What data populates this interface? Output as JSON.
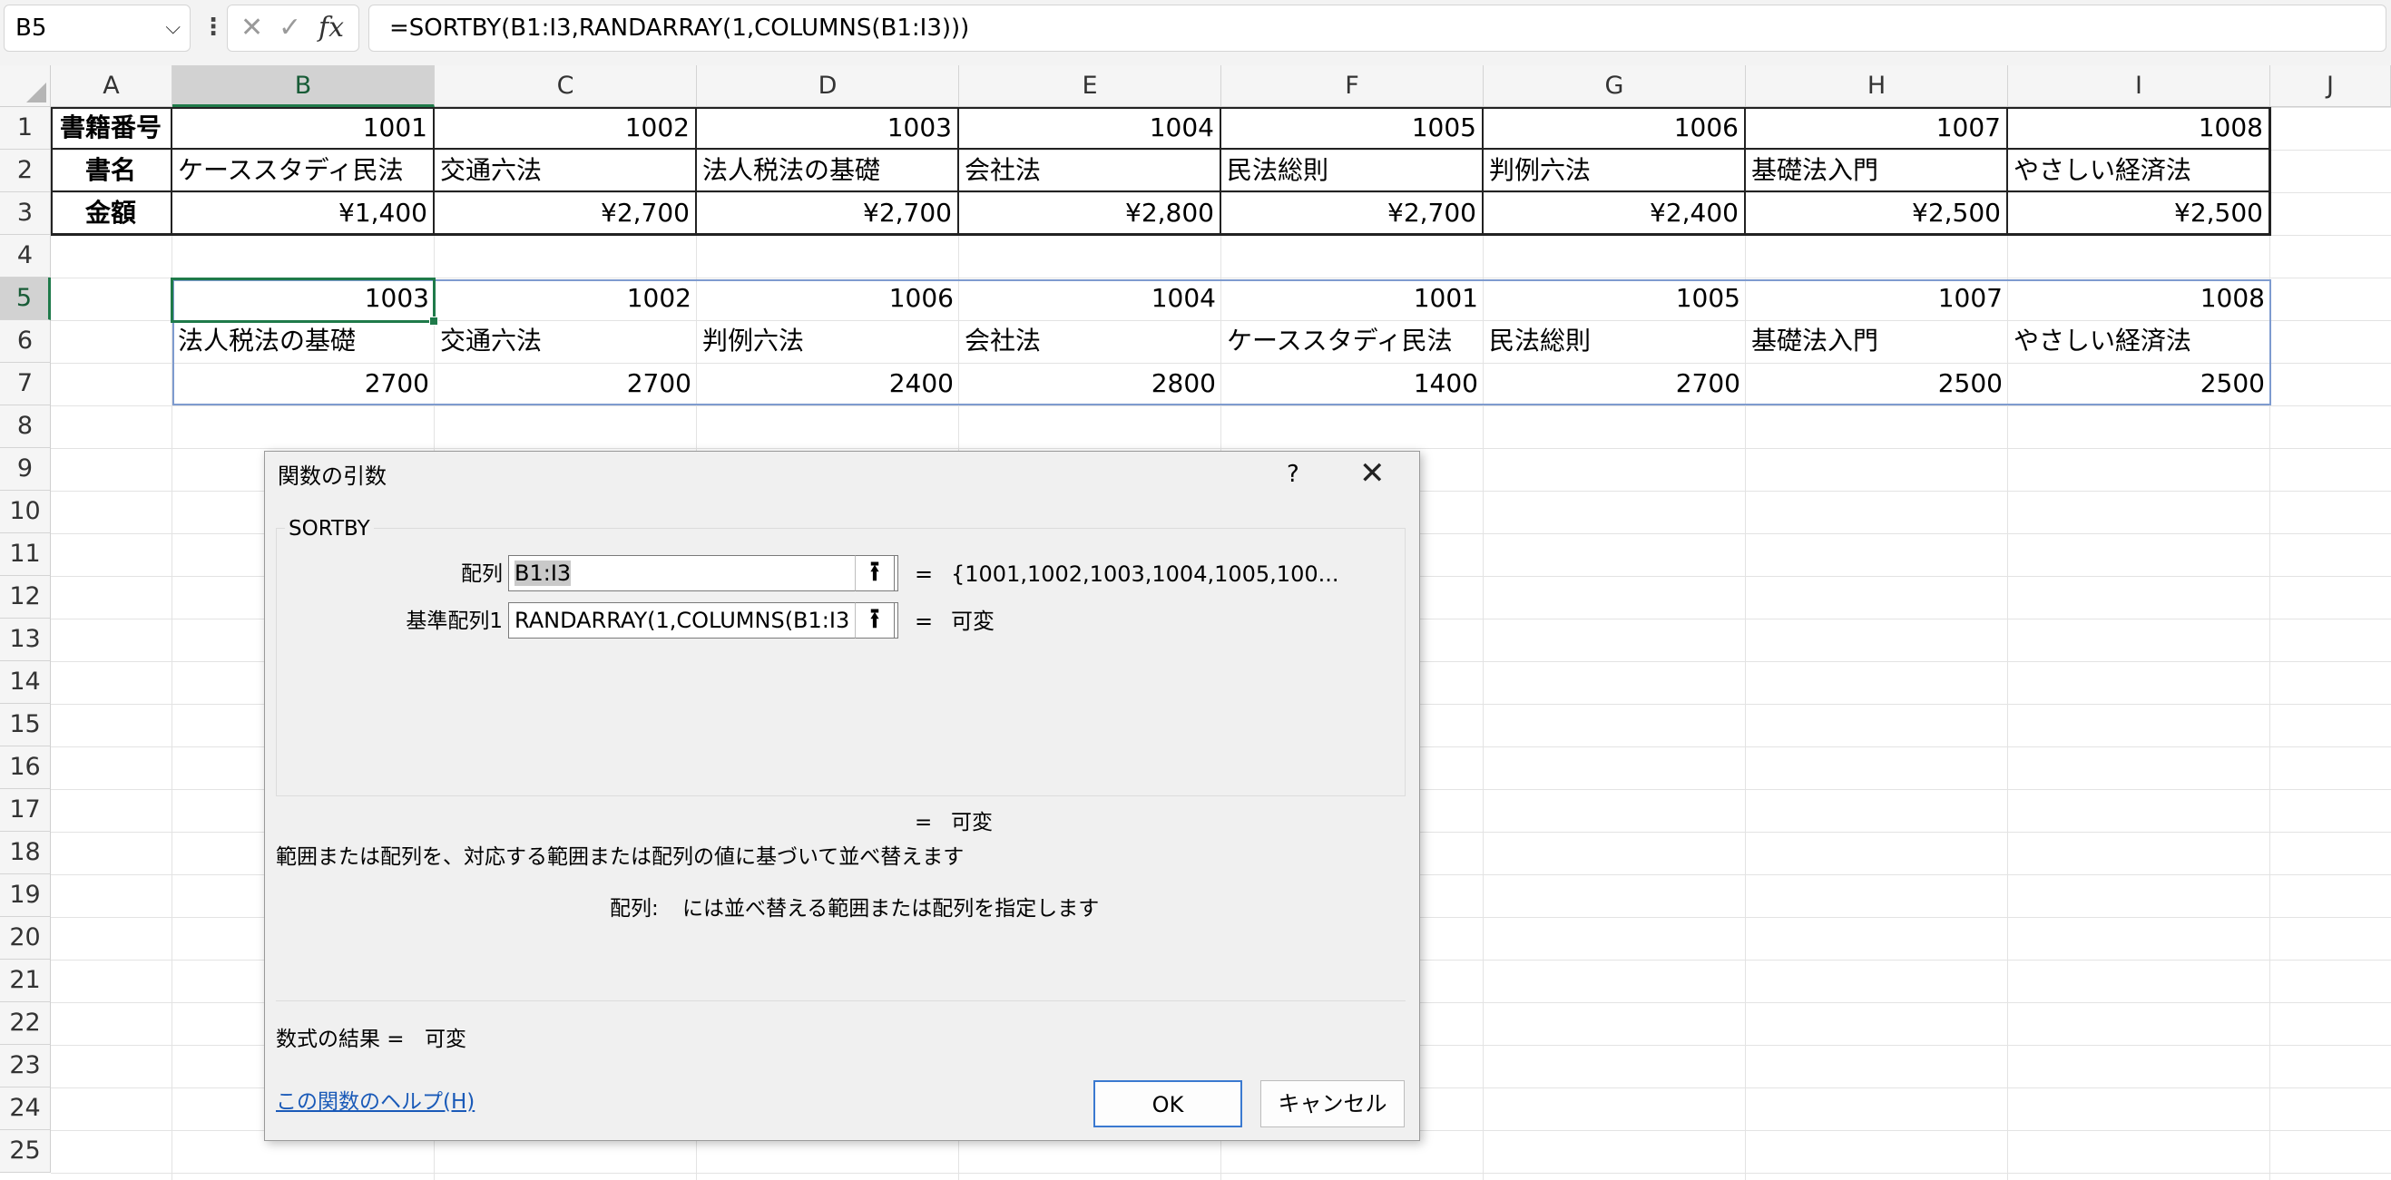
{
  "formula_bar": {
    "name_box": "B5",
    "formula": "=SORTBY(B1:I3,RANDARRAY(1,COLUMNS(B1:I3)))",
    "icons": [
      "chevron-down-icon",
      "more-vertical-icon",
      "cancel-x-icon",
      "confirm-check-icon",
      "fx-icon"
    ]
  },
  "grid": {
    "columns": [
      "A",
      "B",
      "C",
      "D",
      "E",
      "F",
      "G",
      "H",
      "I",
      "J"
    ],
    "rows": [
      "1",
      "2",
      "3",
      "4",
      "5",
      "6",
      "7",
      "8",
      "9",
      "10",
      "11",
      "12",
      "13",
      "14",
      "15",
      "16",
      "17",
      "18",
      "19",
      "20",
      "21",
      "22",
      "23",
      "24",
      "25"
    ],
    "selected_column": "B",
    "selected_row": "5",
    "table": {
      "row_headers": [
        "書籍番号",
        "書名",
        "金額"
      ],
      "ids": [
        "1001",
        "1002",
        "1003",
        "1004",
        "1005",
        "1006",
        "1007",
        "1008"
      ],
      "titles": [
        "ケーススタディ民法",
        "交通六法",
        "法人税法の基礎",
        "会社法",
        "民法総則",
        "判例六法",
        "基礎法入門",
        "やさしい経済法"
      ],
      "prices": [
        "¥1,400",
        "¥2,700",
        "¥2,700",
        "¥2,800",
        "¥2,700",
        "¥2,400",
        "¥2,500",
        "¥2,500"
      ]
    },
    "result": {
      "ids": [
        "1003",
        "1002",
        "1006",
        "1004",
        "1001",
        "1005",
        "1007",
        "1008"
      ],
      "titles": [
        "法人税法の基礎",
        "交通六法",
        "判例六法",
        "会社法",
        "ケーススタディ民法",
        "民法総則",
        "基礎法入門",
        "やさしい経済法"
      ],
      "prices": [
        "2700",
        "2700",
        "2400",
        "2800",
        "1400",
        "2700",
        "2500",
        "2500"
      ]
    }
  },
  "dialog": {
    "title": "関数の引数",
    "help_mark": "?",
    "close_mark": "✕",
    "function_name": "SORTBY",
    "args": [
      {
        "label": "配列",
        "value": "B1:I3",
        "eq": "=",
        "result": "{1001,1002,1003,1004,1005,100..."
      },
      {
        "label": "基準配列1",
        "value": "RANDARRAY(1,COLUMNS(B1:I3",
        "eq": "=",
        "result": "可変"
      }
    ],
    "overall_eq": "=",
    "overall_result": "可変",
    "description": "範囲または配列を、対応する範囲または配列の値に基づいて並べ替えます",
    "arg_help_label": "配列:",
    "arg_help_text": "には並べ替える範囲または配列を指定します",
    "formula_result_label": "数式の結果 =",
    "formula_result_value": "可変",
    "help_link": "この関数のヘルプ(H)",
    "ok_label": "OK",
    "cancel_label": "キャンセル"
  }
}
